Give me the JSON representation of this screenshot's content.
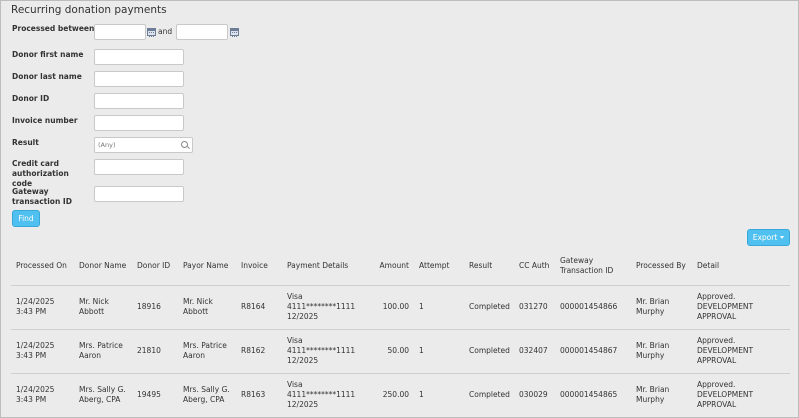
{
  "page": {
    "title": "Recurring donation payments"
  },
  "filters": {
    "processed_between_label": "Processed between",
    "and_label": "and",
    "processed_from": "",
    "processed_to": "",
    "first_name_label": "Donor first name",
    "first_name": "",
    "last_name_label": "Donor last name",
    "last_name": "",
    "donor_id_label": "Donor ID",
    "donor_id": "",
    "invoice_label": "Invoice number",
    "invoice": "",
    "result_label": "Result",
    "result_value": "(Any)",
    "cc_auth_label": "Credit card authorization code",
    "cc_auth": "",
    "gateway_label": "Gateway transaction ID",
    "gateway": "",
    "find_label": "Find"
  },
  "toolbar": {
    "export_label": "Export"
  },
  "table": {
    "columns": {
      "processed_on": "Processed On",
      "donor_name": "Donor Name",
      "donor_id": "Donor ID",
      "payor_name": "Payor Name",
      "invoice": "Invoice",
      "payment_details": "Payment Details",
      "amount": "Amount",
      "attempt": "Attempt",
      "result": "Result",
      "cc_auth": "CC Auth",
      "gateway_id": "Gateway Transaction ID",
      "processed_by": "Processed By",
      "detail": "Detail"
    },
    "rows": [
      {
        "processed_on": "1/24/2025 3:43 PM",
        "donor_name": "Mr. Nick Abbott",
        "donor_id": "18916",
        "payor_name": "Mr. Nick Abbott",
        "invoice": "R8164",
        "payment_details": "Visa 4111********1111 12/2025",
        "amount": "100.00",
        "attempt": "1",
        "result": "Completed",
        "cc_auth": "031270",
        "gateway_id": "000001454866",
        "processed_by": "Mr. Brian Murphy",
        "detail": "Approved. DEVELOPMENT APPROVAL"
      },
      {
        "processed_on": "1/24/2025 3:43 PM",
        "donor_name": "Mrs. Patrice Aaron",
        "donor_id": "21810",
        "payor_name": "Mrs. Patrice Aaron",
        "invoice": "R8162",
        "payment_details": "Visa 4111********1111 12/2025",
        "amount": "50.00",
        "attempt": "1",
        "result": "Completed",
        "cc_auth": "032407",
        "gateway_id": "000001454867",
        "processed_by": "Mr. Brian Murphy",
        "detail": "Approved. DEVELOPMENT APPROVAL"
      },
      {
        "processed_on": "1/24/2025 3:43 PM",
        "donor_name": "Mrs. Sally G. Aberg, CPA",
        "donor_id": "19495",
        "payor_name": "Mrs. Sally G. Aberg, CPA",
        "invoice": "R8163",
        "payment_details": "Visa 4111********1111 12/2025",
        "amount": "250.00",
        "attempt": "1",
        "result": "Completed",
        "cc_auth": "030029",
        "gateway_id": "000001454865",
        "processed_by": "Mr. Brian Murphy",
        "detail": "Approved. DEVELOPMENT APPROVAL"
      }
    ]
  }
}
